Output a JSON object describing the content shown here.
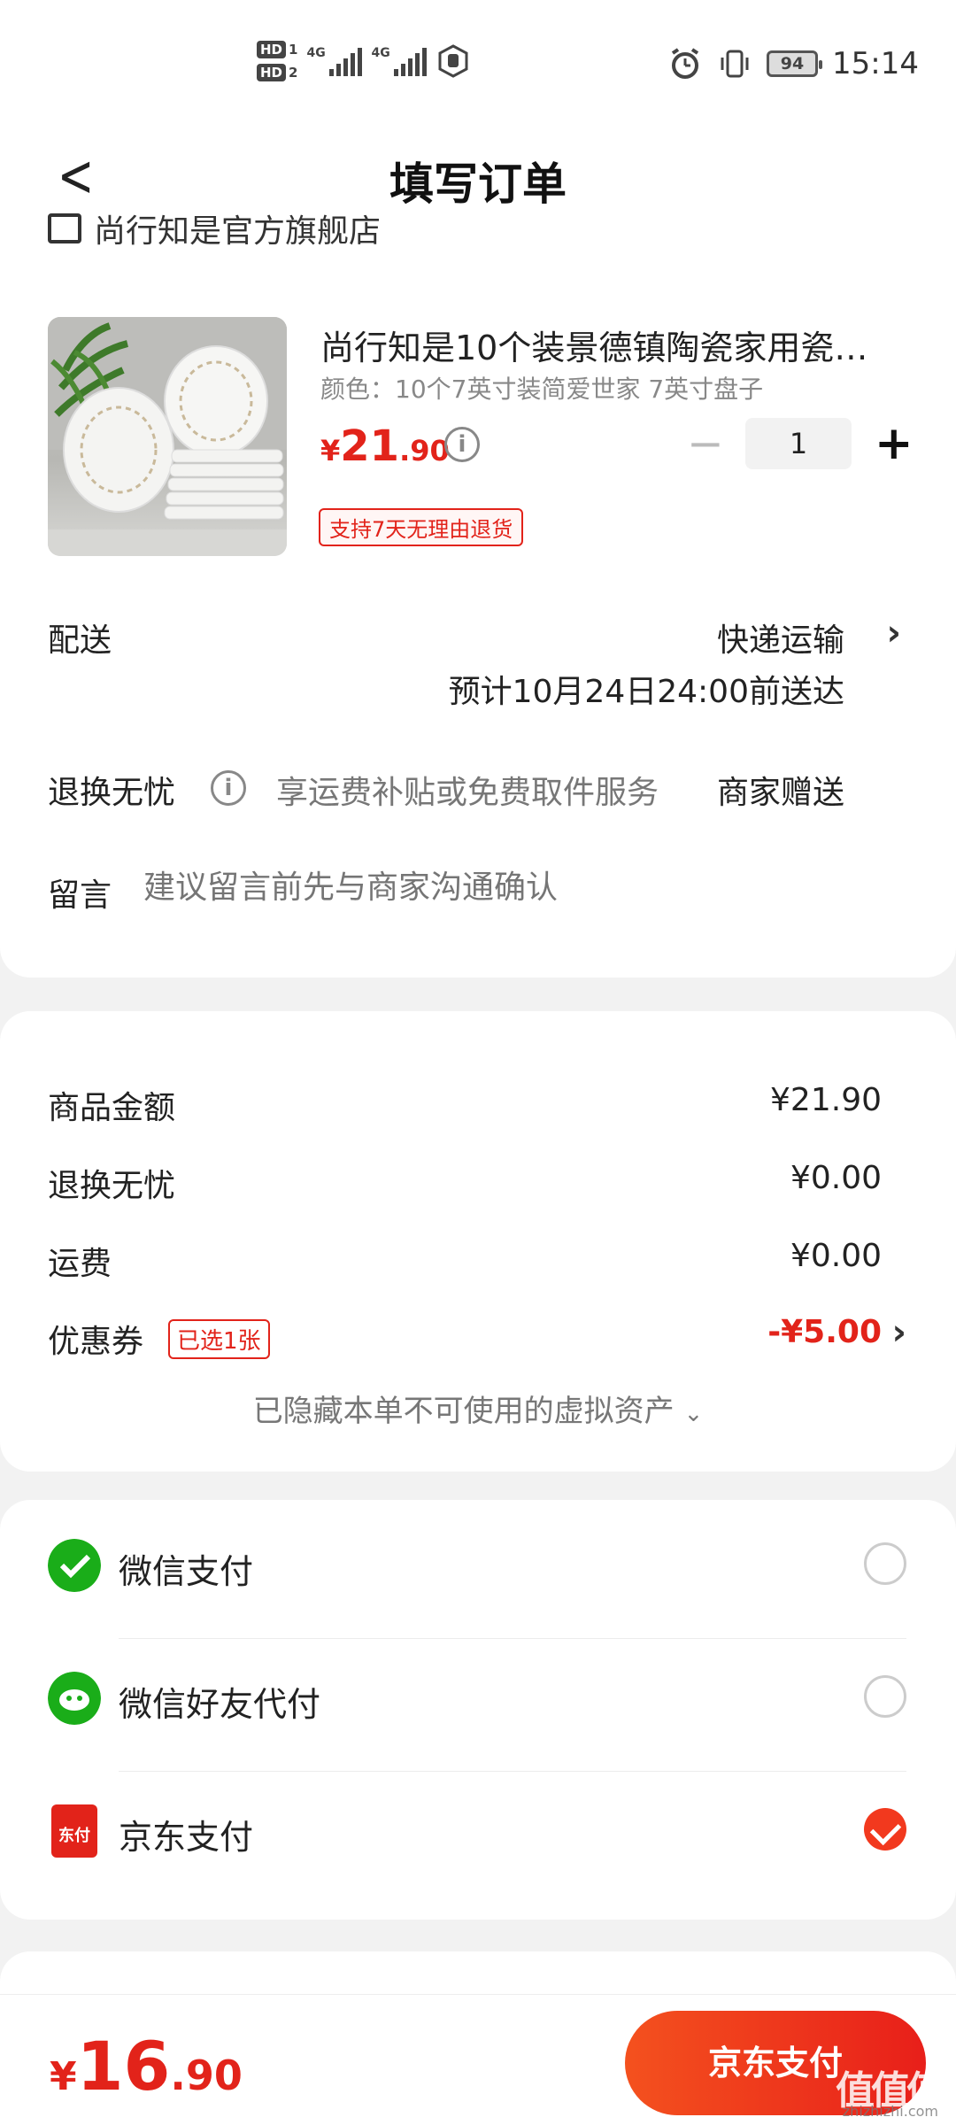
{
  "status_bar": {
    "hd1": "HD",
    "hd1_num": "1",
    "hd2": "HD",
    "hd2_num": "2",
    "sim1": "4G",
    "sim2": "4G",
    "battery": "94",
    "time": "15:14"
  },
  "header": {
    "title": "填写订单",
    "back_icon": "chevron-left-icon"
  },
  "shop": {
    "name": "尚行知是官方旗舰店"
  },
  "product": {
    "title": "尚行知是10个装景德镇陶瓷家用瓷…",
    "spec": "颜色：10个7英寸装简爱世家 7英寸盘子",
    "price_currency": "¥",
    "price_int": "21",
    "price_dec": ".90",
    "quantity": "1",
    "minus": "−",
    "plus": "+",
    "return_tag": "支持7天无理由退货"
  },
  "delivery": {
    "label": "配送",
    "method": "快递运输",
    "eta": "预计10月24日24:00前送达"
  },
  "worry_free": {
    "label": "退换无忧",
    "desc": "享运费补贴或免费取件服务",
    "gift": "商家赠送"
  },
  "message": {
    "label": "留言",
    "placeholder": "建议留言前先与商家沟通确认"
  },
  "amounts": {
    "goods_label": "商品金额",
    "goods_value": "¥21.90",
    "worry_label": "退换无忧",
    "worry_value": "¥0.00",
    "shipping_label": "运费",
    "shipping_value": "¥0.00",
    "coupon_label": "优惠券",
    "coupon_tag": "已选1张",
    "coupon_value": "-¥5.00",
    "hidden_assets": "已隐藏本单不可使用的虚拟资产"
  },
  "payment": {
    "methods": [
      {
        "label": "微信支付",
        "icon": "wechat-pay-icon",
        "selected": false
      },
      {
        "label": "微信好友代付",
        "icon": "wechat-friend-pay-icon",
        "selected": false
      },
      {
        "label": "京东支付",
        "icon": "jd-pay-icon",
        "selected": true
      }
    ],
    "jd_icon_text": "东付"
  },
  "bottom": {
    "total_currency": "¥",
    "total_int": "16",
    "total_dec": ".90",
    "pay_button": "京东支付",
    "watermark": "值值值",
    "watermark_sub": "zhizhizhi.com"
  },
  "colors": {
    "accent": "#e2231a",
    "button": "#f4511e",
    "wechat": "#1aad19"
  }
}
